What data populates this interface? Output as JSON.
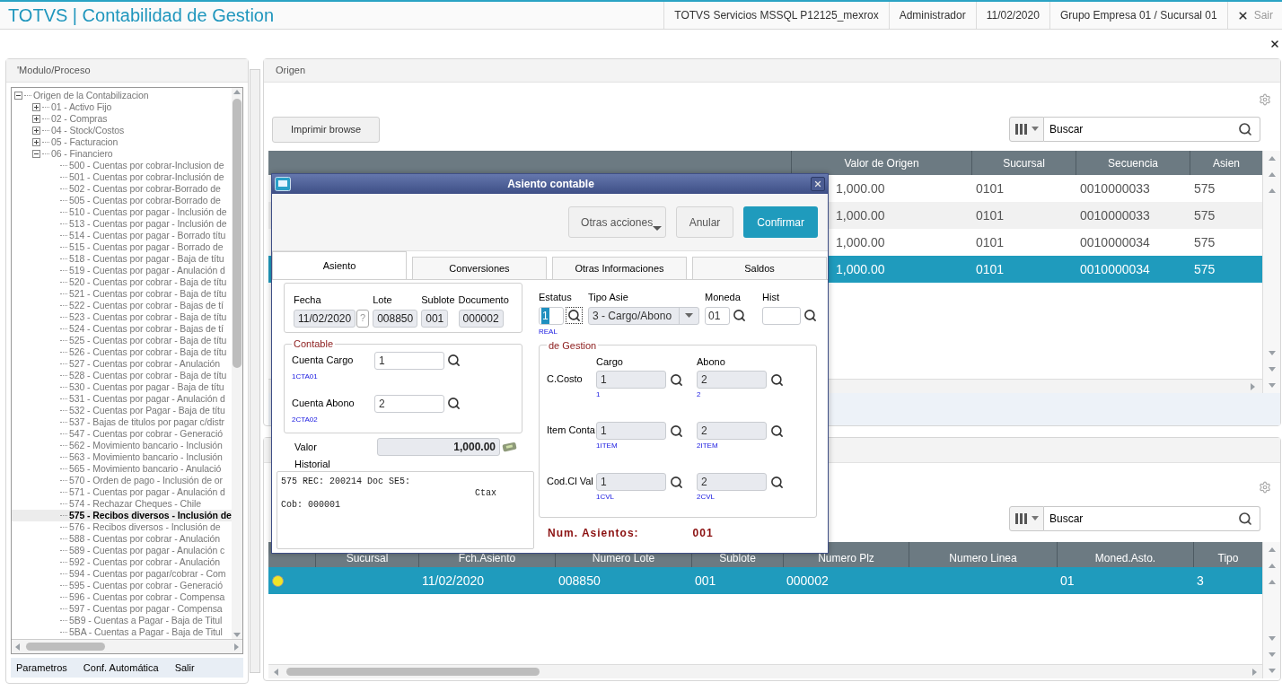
{
  "header": {
    "title": "TOTVS | Contabilidad de Gestion",
    "info": [
      "TOTVS Servicios MSSQL P12125_mexrox",
      "Administrador",
      "11/02/2020",
      "Grupo Empresa 01 / Sucursal 01"
    ],
    "exit": "Sair"
  },
  "sidebar": {
    "title": "'Modulo/Proceso",
    "tree": [
      {
        "label": "Origen de la Contabilizacion",
        "expanded": true,
        "selected": false,
        "children": [
          {
            "label": "01 - Activo Fijo",
            "expanded": false,
            "selected": false
          },
          {
            "label": "02 - Compras",
            "expanded": false,
            "selected": false
          },
          {
            "label": "04 - Stock/Costos",
            "expanded": false,
            "selected": false
          },
          {
            "label": "05 - Facturacion",
            "expanded": false,
            "selected": false
          },
          {
            "label": "06 - Financiero",
            "expanded": true,
            "selected": false,
            "children": [
              {
                "label": "500 - Cuentas por cobrar-Inclusion de",
                "selected": false
              },
              {
                "label": "501 - Cuentas por cobrar-Inclusión de",
                "selected": false
              },
              {
                "label": "502 - Cuentas por cobrar-Borrado de",
                "selected": false
              },
              {
                "label": "505 - Cuentas por cobrar-Borrado de",
                "selected": false
              },
              {
                "label": "510 - Cuentas por pagar - Inclusión de",
                "selected": false
              },
              {
                "label": "513 - Cuentas por pagar - Inclusión de",
                "selected": false
              },
              {
                "label": "514 - Cuentas por pagar - Borrado títu",
                "selected": false
              },
              {
                "label": "515 - Cuentas por pagar - Borrado de",
                "selected": false
              },
              {
                "label": "518 - Cuentas por pagar - Baja de títu",
                "selected": false
              },
              {
                "label": "519 - Cuentas por pagar - Anulación d",
                "selected": false
              },
              {
                "label": "520 - Cuentas por cobrar - Baja de títu",
                "selected": false
              },
              {
                "label": "521 - Cuentas por cobrar - Baja de títu",
                "selected": false
              },
              {
                "label": "522 - Cuentas por cobrar - Bajas de tí",
                "selected": false
              },
              {
                "label": "523 - Cuentas por cobrar - Baja de títu",
                "selected": false
              },
              {
                "label": "524 - Cuentas por cobrar - Bajas de tí",
                "selected": false
              },
              {
                "label": "525 - Cuentas por cobrar - Baja de títu",
                "selected": false
              },
              {
                "label": "526 - Cuentas por cobrar - Baja de títu",
                "selected": false
              },
              {
                "label": "527 - Cuentas por cobrar - Anulación",
                "selected": false
              },
              {
                "label": "528 - Cuentas por cobrar - Baja de títu",
                "selected": false
              },
              {
                "label": "530 - Cuentas por pagar - Baja de títu",
                "selected": false
              },
              {
                "label": "531 - Cuentas por pagar - Anulación d",
                "selected": false
              },
              {
                "label": "532 - Cuentas por Pagar - Baja de títu",
                "selected": false
              },
              {
                "label": "537 - Bajas de titulos por pagar c/distr",
                "selected": false
              },
              {
                "label": "547 - Cuentas por cobrar - Generació",
                "selected": false
              },
              {
                "label": "562 - Movimiento bancario - Inclusión",
                "selected": false
              },
              {
                "label": "563 - Movimiento bancario - Inclusión",
                "selected": false
              },
              {
                "label": "565 - Movimiento bancario - Anulació",
                "selected": false
              },
              {
                "label": "570 - Orden de pago - Inclusión de or",
                "selected": false
              },
              {
                "label": "571 - Cuentas por pagar - Anulación d",
                "selected": false
              },
              {
                "label": "574 - Rechazar Cheques - Chile",
                "selected": false
              },
              {
                "label": "575 - Recibos diversos - Inclusión de",
                "selected": true
              },
              {
                "label": "576 - Recibos diversos - Inclusión de",
                "selected": false
              },
              {
                "label": "588 - Cuentas por cobrar - Anulación",
                "selected": false
              },
              {
                "label": "589 - Cuentas por pagar - Anulación c",
                "selected": false
              },
              {
                "label": "592 - Cuentas por cobrar - Anulación",
                "selected": false
              },
              {
                "label": "594 - Cuentas por pagar/cobrar - Com",
                "selected": false
              },
              {
                "label": "595 - Cuentas por cobrar - Generació",
                "selected": false
              },
              {
                "label": "596 - Cuentas por cobrar - Compensa",
                "selected": false
              },
              {
                "label": "597 - Cuentas por pagar - Compensa",
                "selected": false
              },
              {
                "label": "5B9 - Cuentas a Pagar - Baja de Titul",
                "selected": false
              },
              {
                "label": "5BA - Cuentas a Pagar - Baja de Titul",
                "selected": false
              }
            ]
          }
        ]
      }
    ],
    "buttons": [
      "Parametros",
      "Conf. Automática",
      "Salir"
    ]
  },
  "origin_panel": {
    "title": "Origen",
    "print_button": "Imprimir browse",
    "search": {
      "placeholder": "Buscar"
    },
    "table": {
      "columns": [
        "Valor de Origen",
        "Sucursal",
        "Secuencia",
        "Asien"
      ],
      "rows": [
        {
          "selected": false,
          "cells": [
            "1,000.00",
            "0101",
            "0010000033",
            "575"
          ]
        },
        {
          "selected": false,
          "cells": [
            "1,000.00",
            "0101",
            "0010000033",
            "575"
          ]
        },
        {
          "selected": false,
          "cells": [
            "1,000.00",
            "0101",
            "0010000034",
            "575"
          ]
        },
        {
          "selected": true,
          "cells": [
            "1,000.00",
            "0101",
            "0010000034",
            "575"
          ]
        }
      ]
    }
  },
  "detail_panel": {
    "search": {
      "placeholder": "Buscar"
    },
    "table": {
      "columns": [
        "Sucursal",
        "Fch.Asiento",
        "Numero Lote",
        "Sublote",
        "Numero Plz",
        "Numero Linea",
        "Moned.Asto.",
        "Tipo"
      ],
      "rows": [
        {
          "selected": true,
          "color": "#f0e428",
          "cells": [
            null,
            "11/02/2020",
            "008850",
            "001",
            "000002",
            null,
            "01",
            "3"
          ]
        }
      ]
    }
  },
  "dialog": {
    "title": "Asiento contable",
    "buttons": [
      {
        "label": "Otras acciones",
        "kind": "menu"
      },
      {
        "label": "Anular",
        "kind": "secondary"
      },
      {
        "label": "Confirmar",
        "kind": "primary"
      }
    ],
    "tabs": [
      {
        "label": "Asiento",
        "selected": true
      },
      {
        "label": "Conversiones",
        "selected": false
      },
      {
        "label": "Otras Informaciones",
        "selected": false
      },
      {
        "label": "Saldos",
        "selected": false
      }
    ],
    "header_fields": [
      {
        "label": "Fecha",
        "value": "11/02/2020",
        "help": "?"
      },
      {
        "label": "Lote",
        "value": "008850"
      },
      {
        "label": "Sublote",
        "value": "001"
      },
      {
        "label": "Documento",
        "value": "000002"
      }
    ],
    "contable": {
      "legend": "Contable",
      "fields": [
        {
          "label": "Cuenta Cargo",
          "value": "1",
          "description": "1CTA01"
        },
        {
          "label": "Cuenta Abono",
          "value": "2",
          "description": "2CTA02"
        }
      ]
    },
    "valor": {
      "label": "Valor",
      "value": "1,000.00"
    },
    "historial": {
      "label": "Historial",
      "lines": [
        "575 REC: 200214 Doc SE5:",
        "                                    Ctax",
        "Cob: 000001"
      ]
    },
    "status": {
      "label": "Estatus",
      "value": "1",
      "description": "REAL"
    },
    "entry_type": {
      "label": "Tipo Asie",
      "value": "3 - Cargo/Abono"
    },
    "currency": {
      "label": "Moneda",
      "value": "01"
    },
    "hist": {
      "label": "Hist"
    },
    "gestion": {
      "legend": "de Gestion",
      "columns": [
        "Cargo",
        "Abono"
      ],
      "rows": [
        {
          "label": "C.Costo",
          "values": [
            {
              "value": "1",
              "description": "1"
            },
            {
              "value": "2",
              "description": "2"
            }
          ]
        },
        {
          "label": "Item Conta",
          "values": [
            {
              "value": "1",
              "description": "1ITEM"
            },
            {
              "value": "2",
              "description": "2ITEM"
            }
          ]
        },
        {
          "label": "Cod.Cl Val",
          "values": [
            {
              "value": "1",
              "description": "1CVL"
            },
            {
              "value": "2",
              "description": "2CVL"
            }
          ]
        }
      ]
    },
    "count": {
      "label": "Num. Asientos:",
      "value": "001"
    }
  }
}
